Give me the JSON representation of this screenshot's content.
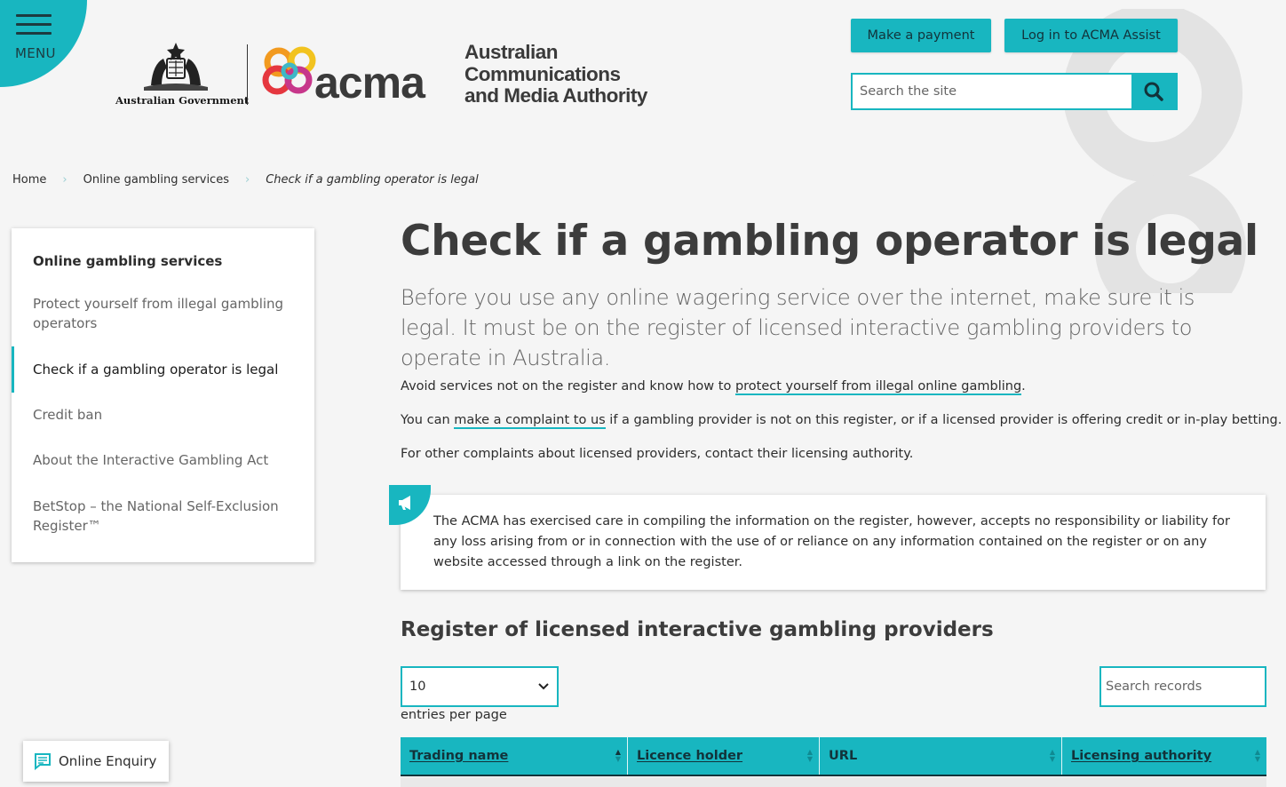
{
  "header": {
    "menu_label": "MENU",
    "gov_label": "Australian Government",
    "acma_word": "acma",
    "authority_name_lines": [
      "Australian",
      "Communications",
      "and Media Authority"
    ],
    "make_payment_label": "Make a payment",
    "login_label": "Log in to ACMA Assist",
    "search_placeholder": "Search the site"
  },
  "breadcrumb": {
    "items": [
      "Home",
      "Online gambling services"
    ],
    "current": "Check if a gambling operator is legal"
  },
  "sidebar": {
    "heading": "Online gambling services",
    "items": [
      "Protect yourself from illegal gambling operators",
      "Check if a gambling operator is legal",
      "Credit ban",
      "About the Interactive Gambling Act",
      "BetStop – the National Self-Exclusion Register™"
    ],
    "active_index": 1
  },
  "main": {
    "title": "Check if a gambling operator is legal",
    "lead": "Before you use any online wagering service over the internet, make sure it is legal. It must be on the register of licensed interactive gambling providers to operate in Australia.",
    "p1_before": "Avoid services not on the register and know how to ",
    "p1_link": "protect yourself from illegal online gambling",
    "p1_after": ".",
    "p2_before": "You can ",
    "p2_link": "make a complaint to us",
    "p2_after": " if a gambling provider is not on this register, or if a licensed provider is offering credit or in-play betting.",
    "p3": "For other complaints about licensed providers, contact their licensing authority.",
    "notice": "The ACMA has exercised care in compiling the information on the register, however, accepts no responsibility or liability for any loss arising from or in connection with the use of or reliance on any information contained on the register or on any website accessed through a link on the register.",
    "section_title": "Register of licensed interactive gambling providers"
  },
  "table_controls": {
    "entries_value": "10",
    "entries_label": "entries per page",
    "search_placeholder": "Search records"
  },
  "table": {
    "columns": [
      "Trading name",
      "Licence holder",
      "URL",
      "Licensing authority"
    ]
  },
  "enquiry_label": "Online Enquiry",
  "colors": {
    "accent": "#18b6c0",
    "text": "#2d2d2d",
    "heading": "#3c3c3c"
  }
}
